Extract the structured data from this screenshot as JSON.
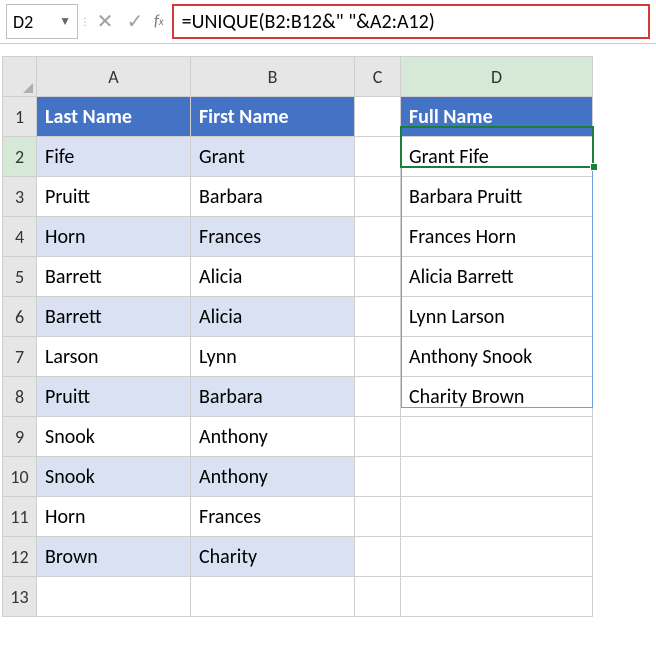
{
  "formula_bar": {
    "cell_ref": "D2",
    "cancel_label": "✕",
    "confirm_label": "✓",
    "fx_label": "f",
    "fx_sub": "x",
    "formula": "=UNIQUE(B2:B12&\" \"&A2:A12)"
  },
  "columns": [
    "A",
    "B",
    "C",
    "D"
  ],
  "rows": [
    "1",
    "2",
    "3",
    "4",
    "5",
    "6",
    "7",
    "8",
    "9",
    "10",
    "11",
    "12",
    "13"
  ],
  "headers": {
    "A": "Last Name",
    "B": "First Name",
    "D": "Full Name"
  },
  "data_rows": [
    {
      "last": "Fife",
      "first": "Grant"
    },
    {
      "last": "Pruitt",
      "first": "Barbara"
    },
    {
      "last": "Horn",
      "first": "Frances"
    },
    {
      "last": "Barrett",
      "first": "Alicia"
    },
    {
      "last": "Barrett",
      "first": "Alicia"
    },
    {
      "last": "Larson",
      "first": "Lynn"
    },
    {
      "last": "Pruitt",
      "first": "Barbara"
    },
    {
      "last": "Snook",
      "first": "Anthony"
    },
    {
      "last": "Snook",
      "first": "Anthony"
    },
    {
      "last": "Horn",
      "first": "Frances"
    },
    {
      "last": "Brown",
      "first": "Charity"
    }
  ],
  "full_names": [
    "Grant Fife",
    "Barbara Pruitt",
    "Frances Horn",
    "Alicia Barrett",
    "Lynn Larson",
    "Anthony Snook",
    "Charity Brown"
  ],
  "chart_data": {
    "type": "table",
    "title": "UNIQUE full-name formula result",
    "columns": [
      "Last Name",
      "First Name",
      "Full Name"
    ],
    "input_rows": [
      [
        "Fife",
        "Grant"
      ],
      [
        "Pruitt",
        "Barbara"
      ],
      [
        "Horn",
        "Frances"
      ],
      [
        "Barrett",
        "Alicia"
      ],
      [
        "Barrett",
        "Alicia"
      ],
      [
        "Larson",
        "Lynn"
      ],
      [
        "Pruitt",
        "Barbara"
      ],
      [
        "Snook",
        "Anthony"
      ],
      [
        "Snook",
        "Anthony"
      ],
      [
        "Horn",
        "Frances"
      ],
      [
        "Brown",
        "Charity"
      ]
    ],
    "output_rows": [
      "Grant Fife",
      "Barbara Pruitt",
      "Frances Horn",
      "Alicia Barrett",
      "Lynn Larson",
      "Anthony Snook",
      "Charity Brown"
    ]
  }
}
